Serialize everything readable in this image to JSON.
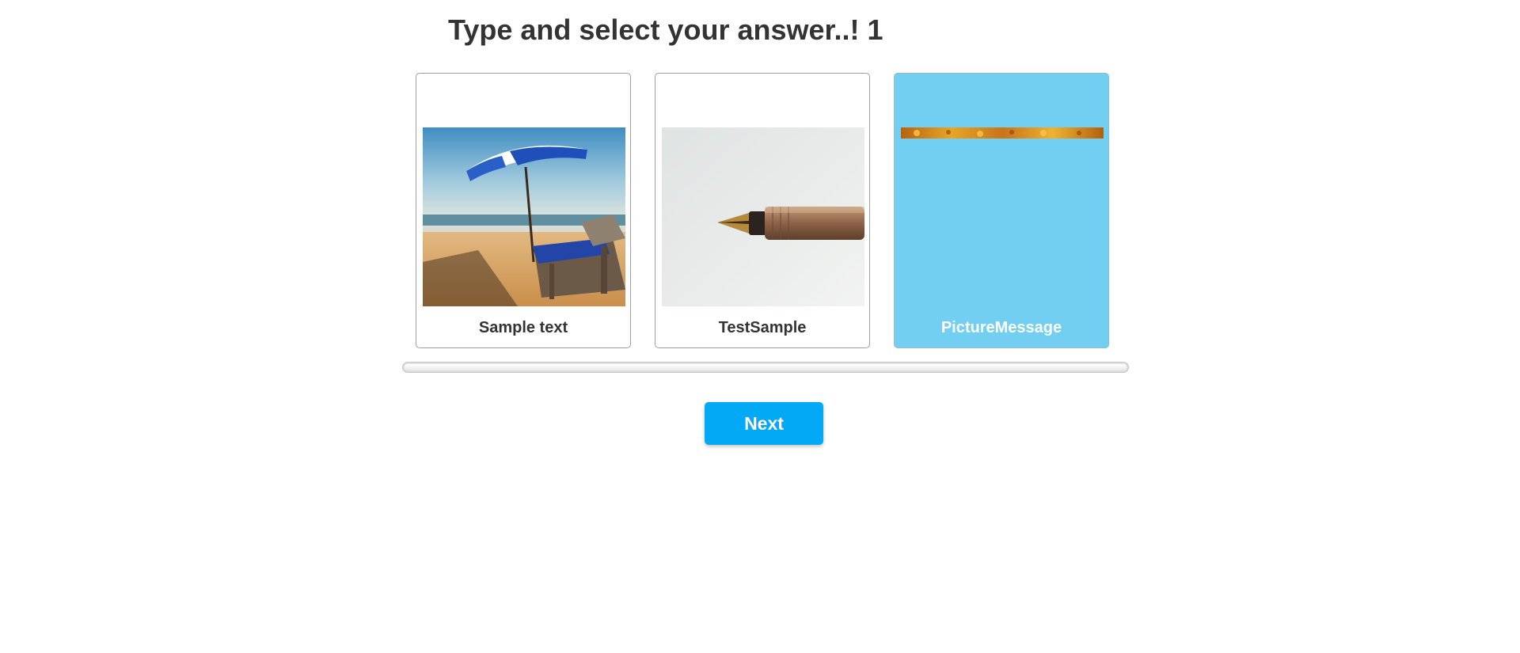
{
  "question": {
    "title": "Type and select your answer..! 1"
  },
  "choices": [
    {
      "label": "Sample text",
      "image": "beach-umbrella-photo",
      "selected": false
    },
    {
      "label": "TestSample",
      "image": "fountain-pen-photo",
      "selected": false
    },
    {
      "label": "PictureMessage",
      "image": "orange-texture-strip",
      "selected": true
    }
  ],
  "next_button": {
    "label": "Next"
  },
  "colors": {
    "selected_card": "#73cff1",
    "button": "#03a9f4",
    "text": "#333333"
  }
}
